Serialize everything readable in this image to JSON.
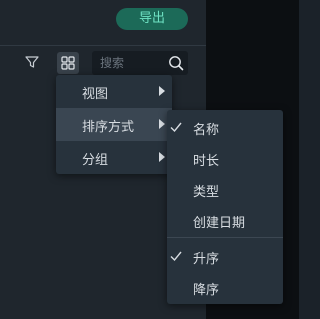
{
  "toolbar": {
    "export_label": "导出",
    "search_placeholder": "搜索"
  },
  "menu": {
    "items": [
      {
        "label": "视图",
        "has_submenu": true
      },
      {
        "label": "排序方式",
        "has_submenu": true,
        "active": true
      },
      {
        "label": "分组",
        "has_submenu": true
      }
    ]
  },
  "sort_submenu": {
    "fields": [
      {
        "label": "名称",
        "checked": true
      },
      {
        "label": "时长",
        "checked": false
      },
      {
        "label": "类型",
        "checked": false
      },
      {
        "label": "创建日期",
        "checked": false
      }
    ],
    "order": [
      {
        "label": "升序",
        "checked": true
      },
      {
        "label": "降序",
        "checked": false
      }
    ]
  },
  "colors": {
    "accent_text": "#6fe3c4",
    "accent_bg": "#1c6a58",
    "menu_bg": "#27323c",
    "menu_active_bg": "#3a4652"
  },
  "icons": [
    "filter-icon",
    "grid-view-icon",
    "search-icon",
    "chevron-right-icon",
    "check-icon"
  ]
}
